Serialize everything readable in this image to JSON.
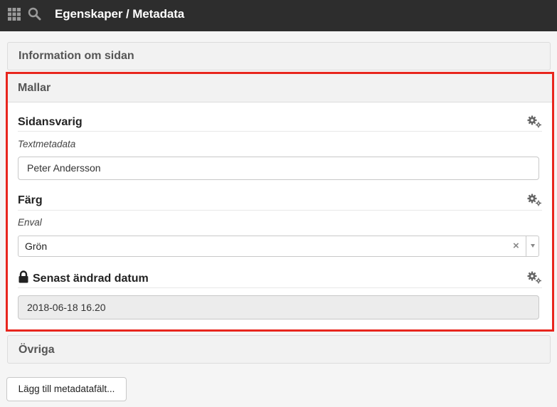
{
  "topbar": {
    "title": "Egenskaper / Metadata",
    "icons": [
      "grid-icon",
      "search-icon"
    ]
  },
  "panels": {
    "information": {
      "title": "Information om sidan"
    },
    "mallar": {
      "title": "Mallar",
      "fields": [
        {
          "title": "Sidansvarig",
          "type": "Textmetadata",
          "value": "Peter Andersson",
          "icon": "gear-icon"
        },
        {
          "title": "Färg",
          "type": "Enval",
          "value": "Grön",
          "clear": "×",
          "icon": "gear-icon"
        },
        {
          "title": "Senast ändrad datum",
          "value": "2018-06-18 16.20",
          "locked": true,
          "icon": "gear-icon"
        }
      ]
    },
    "ovriga": {
      "title": "Övriga"
    }
  },
  "actions": {
    "add_label": "Lägg till metadatafält..."
  },
  "colors": {
    "topbar": "#2d2d2d",
    "highlight": "#e8261e"
  }
}
